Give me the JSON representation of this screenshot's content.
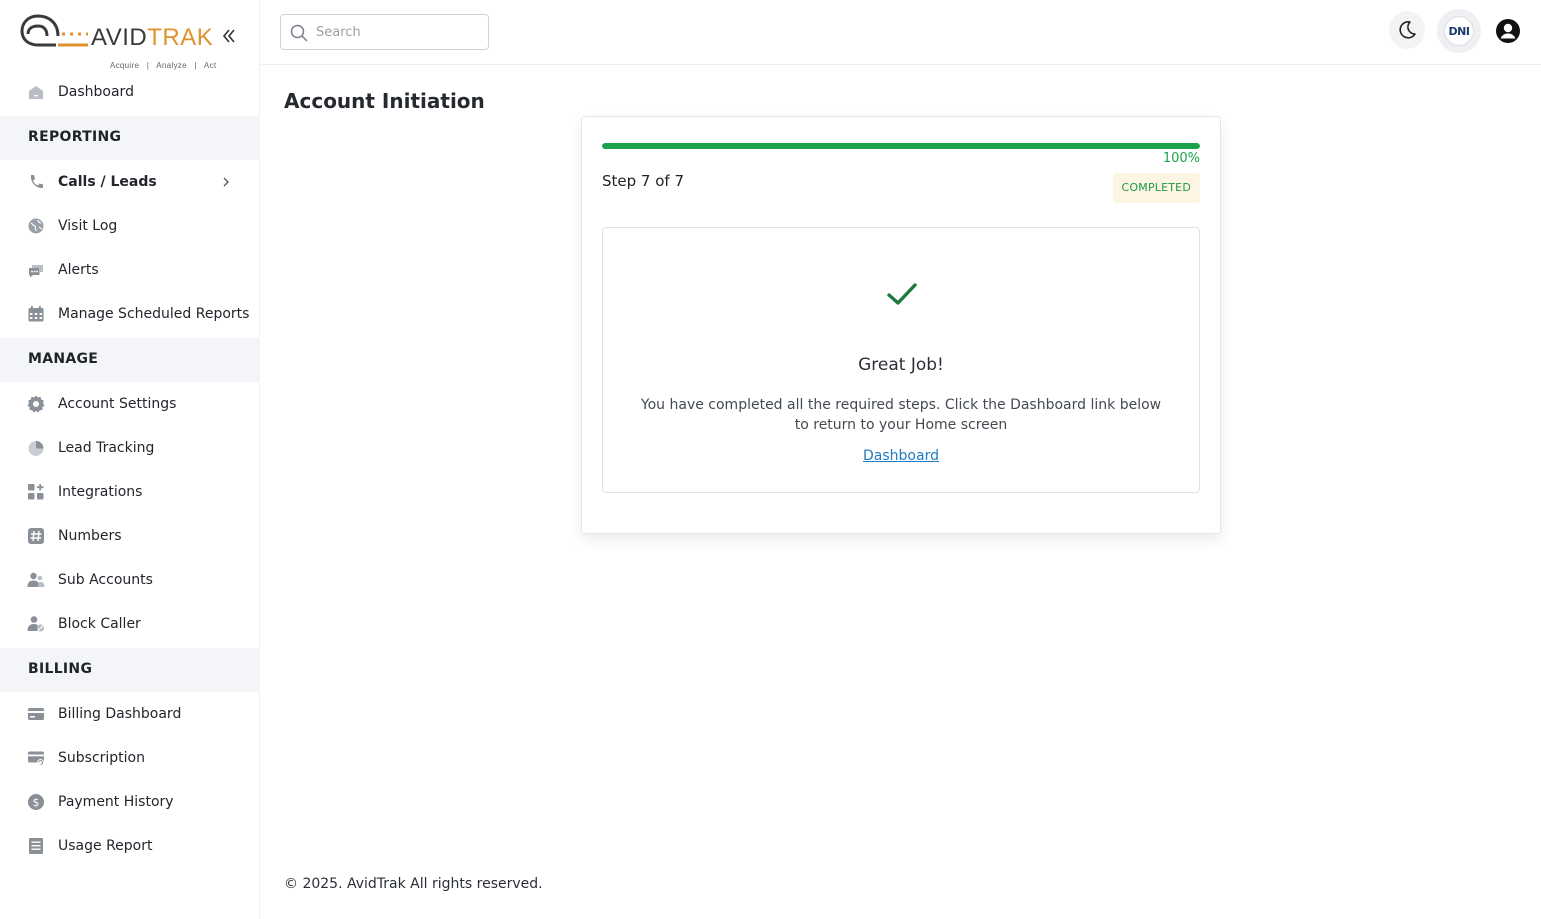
{
  "brand": {
    "name_part1": "AVID",
    "name_part2": "TRAK",
    "tagline": "Acquire   |   Analyze   |   Act",
    "accent_color": "#e0922e"
  },
  "sidebar": {
    "collapse_icon": "double-chevron-left-icon",
    "items": [
      {
        "type": "item",
        "label": "Dashboard",
        "icon": "home-icon"
      },
      {
        "type": "section",
        "label": "REPORTING"
      },
      {
        "type": "item",
        "label": "Calls / Leads",
        "icon": "phone-icon",
        "bold": true,
        "chevron": true
      },
      {
        "type": "item",
        "label": "Visit Log",
        "icon": "globe-icon"
      },
      {
        "type": "item",
        "label": "Alerts",
        "icon": "chat-icon"
      },
      {
        "type": "item",
        "label": "Manage Scheduled Reports",
        "icon": "calendar-icon"
      },
      {
        "type": "section",
        "label": "MANAGE"
      },
      {
        "type": "item",
        "label": "Account Settings",
        "icon": "gear-icon"
      },
      {
        "type": "item",
        "label": "Lead Tracking",
        "icon": "pie-icon"
      },
      {
        "type": "item",
        "label": "Integrations",
        "icon": "apps-add-icon"
      },
      {
        "type": "item",
        "label": "Numbers",
        "icon": "hash-icon"
      },
      {
        "type": "item",
        "label": "Sub Accounts",
        "icon": "users-icon"
      },
      {
        "type": "item",
        "label": "Block Caller",
        "icon": "user-block-icon"
      },
      {
        "type": "section",
        "label": "BILLING"
      },
      {
        "type": "item",
        "label": "Billing Dashboard",
        "icon": "credit-card-icon"
      },
      {
        "type": "item",
        "label": "Subscription",
        "icon": "card-refresh-icon"
      },
      {
        "type": "item",
        "label": "Payment History",
        "icon": "dollar-circle-icon"
      },
      {
        "type": "item",
        "label": "Usage Report",
        "icon": "report-icon"
      }
    ]
  },
  "header": {
    "search_placeholder": "Search",
    "theme_icon": "moon-icon",
    "dni_label": "DNI",
    "user_icon": "user-circle-icon"
  },
  "main": {
    "title": "Account Initiation",
    "progress_percent": 100,
    "progress_label": "100%",
    "step_text": "Step 7 of 7",
    "status_badge": "COMPLETED",
    "success_icon": "checkmark-icon",
    "heading": "Great Job!",
    "message": "You have completed all the required steps. Click the Dashboard link below to return to your Home screen",
    "link_label": "Dashboard",
    "progress_color": "#1aa34a"
  },
  "footer": {
    "text": "© 2025. AvidTrak All rights reserved."
  }
}
